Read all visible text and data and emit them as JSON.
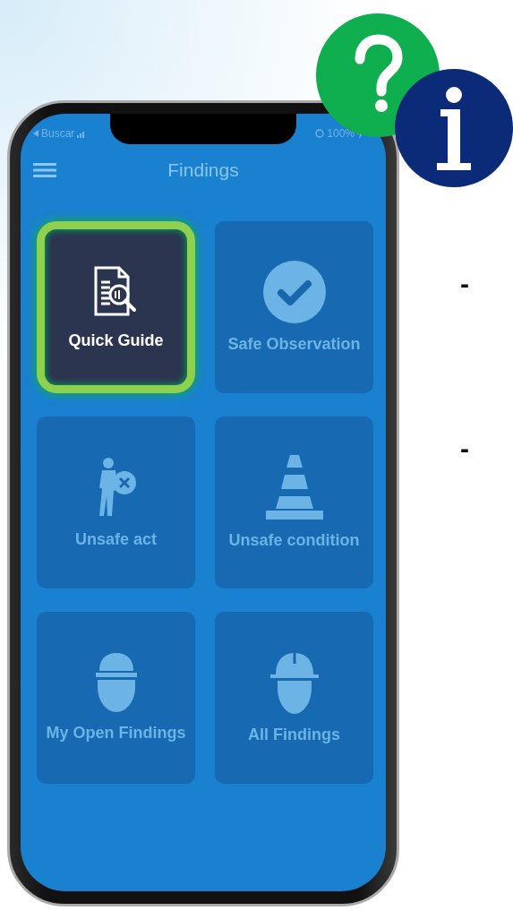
{
  "status_bar": {
    "back_label": "Buscar",
    "battery": "100%"
  },
  "header": {
    "title": "Findings"
  },
  "tiles": [
    {
      "label": "Quick Guide",
      "selected": true
    },
    {
      "label": "Safe Observation",
      "selected": false
    },
    {
      "label": "Unsafe act",
      "selected": false
    },
    {
      "label": "Unsafe condition",
      "selected": false
    },
    {
      "label": "My Open Findings",
      "selected": false
    },
    {
      "label": "All Findings",
      "selected": false
    }
  ],
  "side_bullets": [
    "-",
    "-"
  ]
}
